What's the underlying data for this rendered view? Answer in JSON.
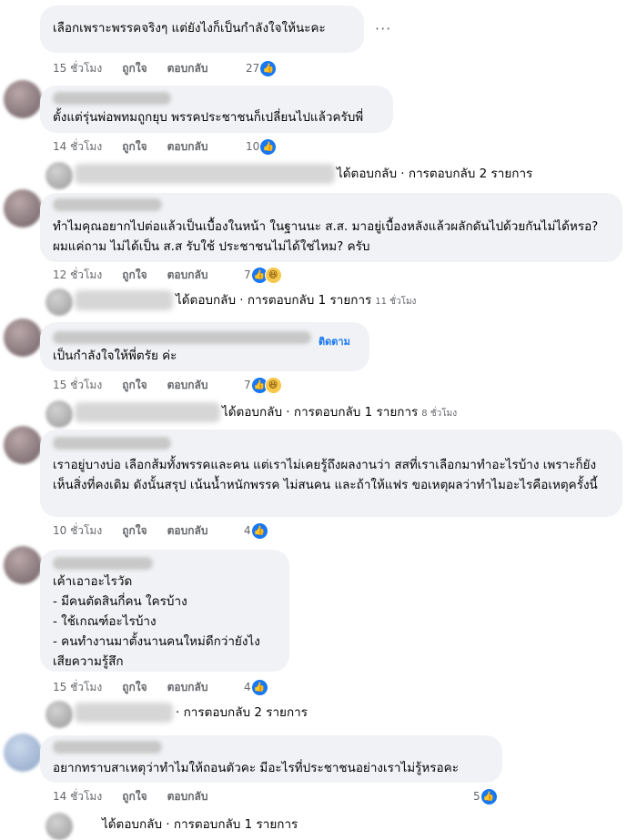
{
  "comments": [
    {
      "text": "เลือกเพราะพรรคจริงๆ แต่ยังไงก็เป็นกำลังใจให้นะคะ",
      "time": "15 ชั่วโมง",
      "like": "ถูกใจ",
      "reply": "ตอบกลับ",
      "count": "27"
    },
    {
      "text": "ตั้งแต่รุ่นพ่อพทมถูกยุบ พรรคประชาชนก็เปลี่ยนไปแล้วครับพี่",
      "time": "14 ชั่วโมง",
      "like": "ถูกใจ",
      "reply": "ตอบกลับ",
      "count": "10",
      "replies": "ได้ตอบกลับ · การตอบกลับ 2 รายการ"
    },
    {
      "text": "ทำไมคุณอยากไปต่อแล้วเป็นเบื้องในหน้า ในฐานนะ ส.ส. มาอยู่เบื้องหลังแล้วผลักดันไปด้วยกันไม่ได้หรอ? ผมแค่ถาม ไม่ได้เป็น ส.ส รับใช้ ประชาชนไม่ได้ใช่ไหม? ครับ",
      "time": "12 ชั่วโมง",
      "like": "ถูกใจ",
      "reply": "ตอบกลับ",
      "count": "7",
      "replies": "ได้ตอบกลับ · การตอบกลับ 1 รายการ",
      "replies_ago": "11 ชั่วโมง"
    },
    {
      "text": "เป็นกำลังใจให้พี่ตรัย ค่ะ",
      "follow": "ติดตาม",
      "time": "15 ชั่วโมง",
      "like": "ถูกใจ",
      "reply": "ตอบกลับ",
      "count": "7",
      "replies": "ได้ตอบกลับ · การตอบกลับ 1 รายการ",
      "replies_ago": "8 ชั่วโมง"
    },
    {
      "text": "เราอยู่บางบ่อ เลือกส้มทั้งพรรคและคน แต่เราไม่เคยรู้ถึงผลงานว่า สสที่เราเลือกมาทำอะไรบ้าง เพราะก็ยังเห็นสิ่งที่คงเดิม ดังนั้นสรุป เน้นน้ำหนักพรรค ไม่สนคน และถ้าให้แฟร ขอเหตุผลว่าทำไมอะไรคือเหตุครั้งนี้",
      "time": "10 ชั่วโมง",
      "like": "ถูกใจ",
      "reply": "ตอบกลับ",
      "count": "4"
    },
    {
      "text": "เค้าเอาอะไรวัด\n- มีคนตัดสินกี่คน ใครบ้าง\n- ใช้เกณฑ์อะไรบ้าง\n- คนทำงานมาตั้งนานคนใหม่ดีกว่ายังไง\nเสียความรู้สึก",
      "time": "15 ชั่วโมง",
      "like": "ถูกใจ",
      "reply": "ตอบกลับ",
      "count": "4",
      "replies": "· การตอบกลับ 2 รายการ"
    },
    {
      "text": "อยากทราบสาเหตุว่าทำไมให้ถอนตัวคะ มีอะไรที่ประชาชนอย่างเราไม่รู้หรอคะ",
      "time": "14 ชั่วโมง",
      "like": "ถูกใจ",
      "reply": "ตอบกลับ",
      "count": "5",
      "replies": "ได้ตอบกลับ · การตอบกลับ 1 รายการ"
    }
  ],
  "more_icon": "more-options-icon",
  "colors": {
    "bubble": "#f0f2f5",
    "meta": "#65676b",
    "like_blue": "#1877f2"
  }
}
